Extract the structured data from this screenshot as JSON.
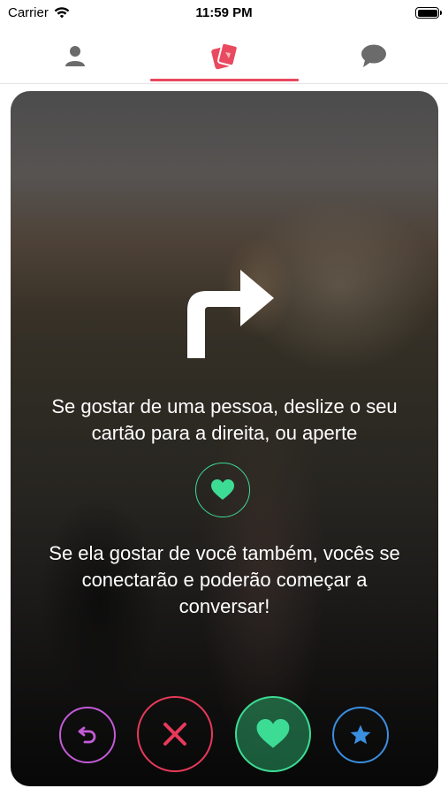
{
  "status_bar": {
    "carrier": "Carrier",
    "time": "11:59 PM"
  },
  "tabs": [
    {
      "name": "profile",
      "icon": "person-icon",
      "active": false
    },
    {
      "name": "cards",
      "icon": "cards-icon",
      "active": true
    },
    {
      "name": "messages",
      "icon": "chat-bubble-icon",
      "active": false
    }
  ],
  "tutorial": {
    "line1": "Se gostar de uma pessoa, deslize o seu cartão para a direita, ou aperte",
    "line2": "Se ela gostar de você também, vocês se conectarão e poderão começar a conversar!"
  },
  "actions": [
    {
      "name": "rewind",
      "icon": "rewind-icon",
      "color": "#c35bd8"
    },
    {
      "name": "nope",
      "icon": "close-icon",
      "color": "#e8395a"
    },
    {
      "name": "like",
      "icon": "heart-icon",
      "color": "#3ddc95"
    },
    {
      "name": "super-like",
      "icon": "star-icon",
      "color": "#3a8fe0"
    }
  ],
  "colors": {
    "accent": "#e94a5f",
    "inactive_icon": "#6b6b6b"
  }
}
